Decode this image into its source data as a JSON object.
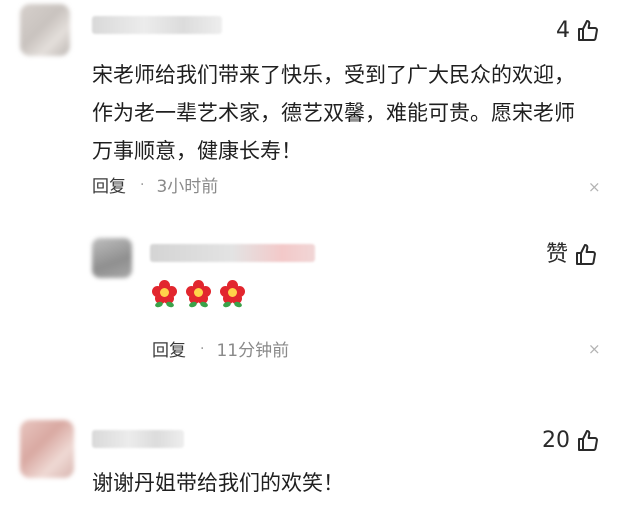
{
  "comments": [
    {
      "likes": "4",
      "text": "宋老师给我们带来了快乐，受到了广大民众的欢迎，\n作为老一辈艺术家，德艺双馨，难能可贵。愿宋老师\n万事顺意，健康长寿！",
      "reply_label": "回复",
      "separator": "·",
      "time": "3小时前",
      "close": "×"
    },
    {
      "likes": "赞",
      "reply_label": "回复",
      "separator": "·",
      "time": "11分钟前",
      "close": "×"
    },
    {
      "likes": "20",
      "text": "谢谢丹姐带给我们的欢笑！"
    }
  ],
  "colors": {
    "text": "#1f1f1f",
    "meta": "#8a8a8a",
    "flower": "#e2262e"
  },
  "icons": {
    "like": "thumbs-up-icon",
    "close": "close-icon",
    "emoji": "flower-emoji-icon"
  }
}
